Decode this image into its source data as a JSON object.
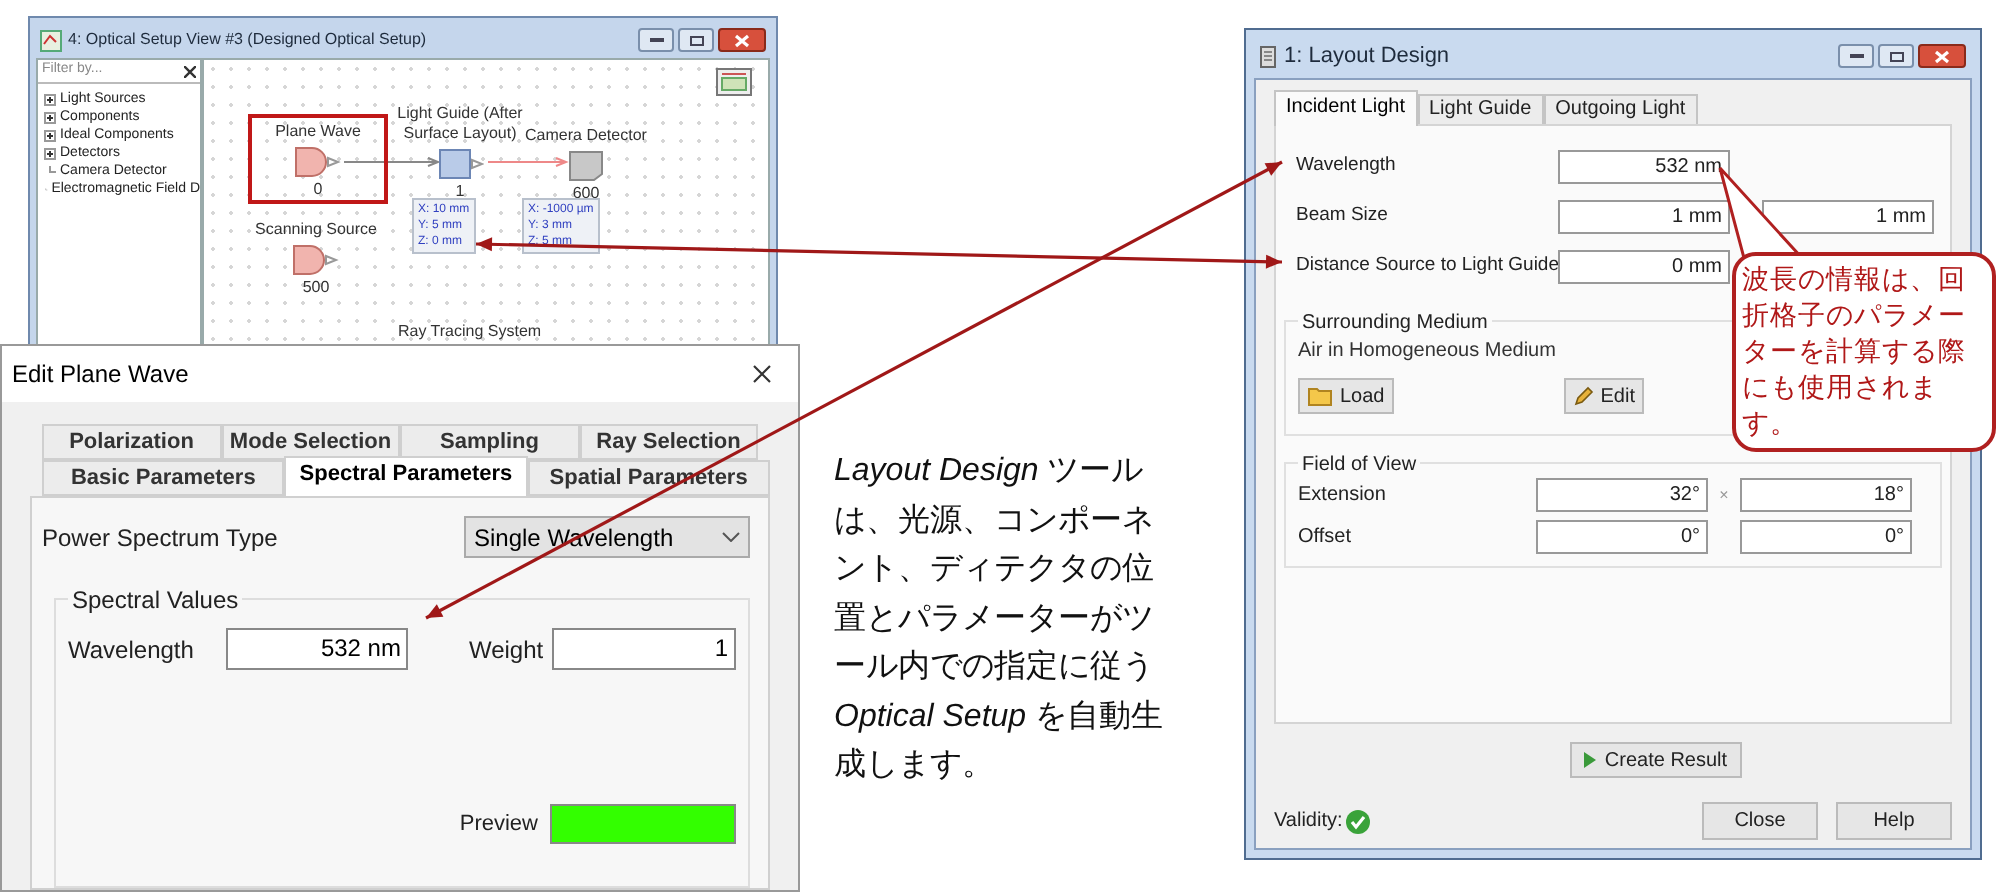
{
  "setup_window": {
    "title": "4: Optical Setup View #3 (Designed Optical Setup)",
    "filter_placeholder": "Filter by...",
    "tree": [
      {
        "label": "Light Sources",
        "expandable": true
      },
      {
        "label": "Components",
        "expandable": true
      },
      {
        "label": "Ideal Components",
        "expandable": true
      },
      {
        "label": "Detectors",
        "expandable": true
      },
      {
        "label": "Camera Detector",
        "expandable": false
      },
      {
        "label": "Electromagnetic Field D",
        "expandable": false
      }
    ],
    "nodes": [
      {
        "label": "Plane Wave",
        "number": "0",
        "kind": "source",
        "selected": true
      },
      {
        "label": "Light Guide (After Surface Layout)",
        "number": "1",
        "kind": "component",
        "selected": false
      },
      {
        "label": "Camera Detector",
        "number": "600",
        "kind": "detector",
        "selected": false
      },
      {
        "label": "Scanning Source",
        "number": "500",
        "kind": "source",
        "selected": false
      }
    ],
    "position_boxes": [
      {
        "lines": [
          "X: 10 mm",
          "Y: 5 mm",
          "Z: 0 mm"
        ]
      },
      {
        "lines": [
          "X: -1000 µm",
          "Y: 3 mm",
          "Z: 5 mm"
        ]
      }
    ],
    "system_label": "Ray Tracing System"
  },
  "edit_dialog": {
    "title": "Edit Plane Wave",
    "tab_rows": [
      {
        "tabs": [
          {
            "label": "Polarization",
            "selected": false
          },
          {
            "label": "Mode Selection",
            "selected": false
          },
          {
            "label": "Sampling",
            "selected": false
          },
          {
            "label": "Ray Selection",
            "selected": false
          }
        ]
      },
      {
        "tabs": [
          {
            "label": "Basic Parameters",
            "selected": false
          },
          {
            "label": "Spectral Parameters",
            "selected": true
          },
          {
            "label": "Spatial Parameters",
            "selected": false
          }
        ]
      }
    ],
    "power_spectrum": {
      "label": "Power Spectrum Type",
      "value": "Single Wavelength"
    },
    "spectral_values": {
      "title": "Spectral Values",
      "wavelength": {
        "label": "Wavelength",
        "value": "532 nm"
      },
      "weight": {
        "label": "Weight",
        "value": "1"
      },
      "preview_label": "Preview"
    }
  },
  "caption": "*Layout Design* ツールは、光源、コンポーネント、ディテクタの位置とパラメーターがツール内での指定に従う *Optical Setup* を自動生成します。",
  "layout_window": {
    "title": "1: Layout Design",
    "tabs": [
      {
        "label": "Incident Light",
        "selected": true
      },
      {
        "label": "Light Guide",
        "selected": false
      },
      {
        "label": "Outgoing Light",
        "selected": false
      }
    ],
    "rows": [
      {
        "label": "Wavelength",
        "values": [
          "532 nm"
        ]
      },
      {
        "label": "Beam Size",
        "values": [
          "1 mm",
          "1 mm"
        ]
      },
      {
        "label": "Distance Source to Light Guide",
        "values": [
          "0 mm"
        ]
      }
    ],
    "surrounding_medium": {
      "title": "Surrounding Medium",
      "value": "Air in Homogeneous Medium",
      "buttons": [
        {
          "label": "Load",
          "kind": "folder"
        },
        {
          "label": "Edit",
          "kind": "pencil"
        }
      ]
    },
    "field_of_view": {
      "title": "Field of View",
      "rows": [
        {
          "label": "Extension",
          "values": [
            "32°",
            "18°"
          ],
          "separator": "×"
        },
        {
          "label": "Offset",
          "values": [
            "0°",
            "0°"
          ]
        }
      ]
    },
    "create_button": "Create Result",
    "validity": {
      "label": "Validity:",
      "valid": true
    },
    "buttons": [
      "Close",
      "Help"
    ]
  },
  "callout": "波長の情報は、回折格子のパラメーターを計算する際にも使用されます。"
}
